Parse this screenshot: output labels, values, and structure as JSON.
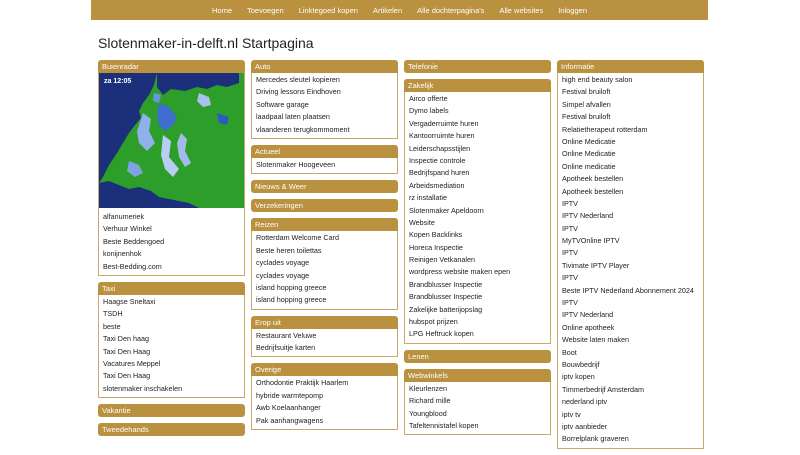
{
  "nav": [
    "Home",
    "Toevoegen",
    "Linktegoed kopen",
    "Artikelen",
    "Alle dochterpagina's",
    "Alle websites",
    "Inloggen"
  ],
  "page_title": "Slotenmaker-in-delft.nl Startpagina",
  "radar_time": "za 12:05",
  "col1": {
    "buienradar": {
      "title": "Buienradar",
      "items": [
        "alfanumeriek",
        "Verhuur Winkel",
        "Beste Beddengoed",
        "konijnenhok",
        "Best-Bedding.com"
      ]
    },
    "taxi": {
      "title": "Taxi",
      "items": [
        "Haagse Sneltaxi",
        "TSDH",
        "beste",
        "Taxi Den haag",
        "Taxi Den Haag",
        "Vacatures Meppel",
        "Taxi Den Haag",
        "slotenmaker inschakelen"
      ]
    },
    "vakantie": {
      "title": "Vakantie"
    },
    "tweedehands": {
      "title": "Tweedehands"
    }
  },
  "col2": {
    "auto": {
      "title": "Auto",
      "items": [
        "Mercedes sleutel kopieren",
        "Driving lessons Eindhoven",
        "Software garage",
        "laadpaal laten plaatsen",
        "vlaanderen terugkommoment"
      ]
    },
    "actueel": {
      "title": "Actueel",
      "items": [
        "Slotenmaker Hoogeveen"
      ]
    },
    "nieuws": {
      "title": "Nieuws & Weer"
    },
    "verzekeringen": {
      "title": "Verzekeringen"
    },
    "reizen": {
      "title": "Reizen",
      "items": [
        "Rotterdam Welcome Card",
        "Beste heren toilettas",
        "cyclades voyage",
        "cyclades voyage",
        "island hopping greece",
        "island hopping greece"
      ]
    },
    "eropuit": {
      "title": "Erop uit",
      "items": [
        "Restaurant Veluwe",
        "Bedrijfsuitje karten"
      ]
    },
    "overige": {
      "title": "Overige",
      "items": [
        "Orthodontie Praktijk Haarlem",
        "hybride warmtepomp",
        "Awb Koelaanhanger",
        "Pak aanhangwagens"
      ]
    }
  },
  "col3": {
    "telefonie": {
      "title": "Telefonie"
    },
    "zakelijk": {
      "title": "Zakelijk",
      "items": [
        "Airco offerte",
        "Dymo labels",
        "Vergaderruimte huren",
        "Kantoorruimte huren",
        "Leiderschapsstijlen",
        "Inspectie controle",
        "Bedrijfspand huren",
        "Arbeidsmediation",
        "rz installatie",
        "Slotenmaker Apeldoorn",
        "Website",
        "Kopen Backlinks",
        "Horeca Inspectie",
        "Reinigen Vetkanalen",
        "wordpress website maken epen",
        "Brandblusser Inspectie",
        "Brandblusser Inspectie",
        "Zakelijke batterijopslag",
        "hubspot prijzen",
        "LPG Heftruck kopen"
      ]
    },
    "lenen": {
      "title": "Lenen"
    },
    "webwinkels": {
      "title": "Webwinkels",
      "items": [
        "Kleurlenzen",
        "Richard mille",
        "Youngblood",
        "Tafeltennistafel kopen"
      ]
    }
  },
  "col4": {
    "informatie": {
      "title": "Informatie",
      "items": [
        "high end beauty salon",
        "Festival bruiloft",
        "Simpel afvallen",
        "Festival bruiloft",
        "Relatietherapeut rotterdam",
        "Online Medicatie",
        "Online Medicatie",
        "Online medicatie",
        "Apotheek bestellen",
        "Apotheek bestellen",
        "IPTV",
        "IPTV Nederland",
        "IPTV",
        "MyTVOnline IPTV",
        "IPTV",
        "Tivimate IPTV Player",
        "IPTV",
        "Beste IPTV Nederland Abonnement 2024",
        "IPTV",
        "IPTV Nederland",
        "Online apotheek",
        "Website laten maken",
        "Boot",
        "Bouwbedrijf",
        "iptv kopen",
        "Timmerbedrijf Amsterdam",
        "nederland iptv",
        "iptv tv",
        "iptv aanbieder",
        "Borrelplank graveren"
      ]
    }
  }
}
